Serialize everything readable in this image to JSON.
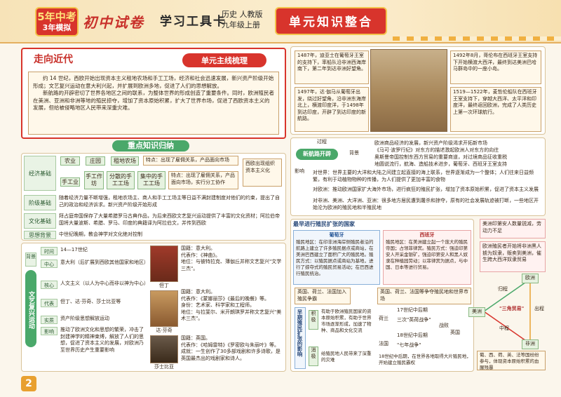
{
  "header": {
    "logo_top": "5年中考",
    "logo_bottom": "3年模拟",
    "brand": "初中试卷",
    "tool": "学习工具卡",
    "subject_line1": "历史 人教版",
    "subject_line2": "九年级上册",
    "unit_banner": "单元知识整合"
  },
  "intro": {
    "title": "走向近代",
    "ribbon": "单元主线梳理",
    "para1": "约 14 世纪，西欧开始出现资本主义租地农场和手工工场，经济和社会迅速发展，新兴资产阶级开始形成；文艺复兴运动在意大利兴起，并扩展到欧洲多地，促进了人们的思想解放。",
    "para2": "新航路的开辟密切了世界各地区之间的联系，为整体世界的形成创造了重要条件。同时，欧洲殖民者在美洲、亚洲和非洲等地的殖民掠夺，增加了资本原始积累，扩大了世界市场，促进了西欧资本主义的发展，但给被侵略地区人民带来深重灾难。"
  },
  "summary": {
    "ribbon": "重点知识归纳",
    "labels": {
      "economy": "经济基础",
      "class": "阶级基础",
      "culture": "文化基础",
      "thought": "思想背景"
    },
    "agri": "农业",
    "manor": "庄园",
    "farm": "租地农场",
    "agri_feature": "特点：出现了雇佣关系，产品面向市场",
    "handicraft": "手工业",
    "hand_work": "手工作坊",
    "scattered": "分散的手工工场",
    "concentrated": "集中的手工工场",
    "hand_feature": "特点：出现了雇佣关系，产品面向市场，实行分工协作",
    "result": "西欧出现组织资本主义化",
    "class_text": "随着经济力量不断增强，租地农场主、商人和手工工场主等日益不满封建制度对他们的约束，提出了自己的政治和经济诉求。新兴资产阶级开始形成",
    "culture_text": "拜占庭帝国保存了大量希腊罗马古典作品，为后来西欧文艺复兴运动提供了丰富的文化资材；阿拉伯帝国将大量波斯、希腊、罗马、印度的典籍译为阿拉伯文，并传到西欧",
    "thought_text": "中世纪晚期，教会神学对文化绝对控制"
  },
  "renaissance": {
    "side_top": "背景",
    "side_title": "文艺复兴运动",
    "rows": [
      {
        "label": "时间",
        "text": "14—17世纪"
      },
      {
        "label": "中心",
        "text": "意大利（后扩展到西欧其他国家和地区）"
      },
      {
        "label": "核心",
        "text": "人文主义（以人为中心而非以神为中心）"
      },
      {
        "label": "代表",
        "text": "但丁、达·芬奇、莎士比亚等"
      },
      {
        "label": "实质",
        "text": "资产阶级思想解放运动"
      },
      {
        "label": "影响",
        "text": "推动了欧洲文化和思想的繁荣，冲击了封建神学的精神束缚，解放了人们的思想，促进了资本主义的发展，对欧洲乃至世界历史产生重要影响"
      }
    ],
    "people": [
      {
        "name": "但丁",
        "info": "国籍：意大利。\n代表作：《神曲》。\n地位：与彼特拉克、薄伽丘并称文艺复兴\"文学三杰\"。"
      },
      {
        "name": "达·芬奇",
        "info": "国籍：意大利。\n代表作：《蒙娜丽莎》《最后的晚餐》等。\n身份：艺术家、科学家和工程师。\n地位：与拉斐尔、米开朗琪罗并称文艺复兴\"美术三杰\"。"
      },
      {
        "name": "莎士比亚",
        "info": "国籍：英国。\n代表作：《哈姆雷特》《罗密欧与朱丽叶》等。\n成就：一生创作了30多部戏剧和许多诗歌，是英国最杰出的戏剧家和诗人。"
      }
    ]
  },
  "voyages": {
    "dias": "1487年，迪亚士在葡萄牙王室的支持下，率船队沿非洲西海岸南下，第二年到达非洲好望角。",
    "columbus": "1492年8月，哥伦布在西班牙王室支持下开始横渡大西洋，最终到达美洲巴哈马群岛中的一座小岛。",
    "gama": "1497年，达·伽马从葡萄牙出发，绕过好望角，沿非洲东海岸北上，横渡印度洋，于1498年到达印度，开辟了到达印度的新航路。",
    "magellan": "1519—1522年，麦哲伦船队在西班牙王室支持下，穿越大西洋、太平洋和印度洋，最终返回欧洲，完成了人类历史上第一次环球航行。"
  },
  "newroute": {
    "title": "新航路开辟",
    "process": "过程",
    "background": "背景",
    "impact": "影响",
    "bg1": "欧洲商品经济的发展，新兴资产阶级渴求开拓新市场",
    "bg2": "《马可·波罗行纪》对东方的描述激起欧洲人对东方的向往",
    "bg3": "奥斯曼帝国控制东西方贸易的重要商道，对过境商品征收重税",
    "bg4": "地圆说流行，航海、造船技术进步，葡萄牙、西班牙王室支持",
    "imp1": "对世界：世界主要的大洋和大陆之间建立起直接的海上联系，世界逐渐成为一个整体；人们往来日益频繁，有利于动植物物种的传播，为人们提供了更加丰富的食物",
    "imp2": "对欧洲：推动欧洲国家扩大海外市场，进行疯狂的殖民扩张，增加了资本原始积累，促进了资本主义发展",
    "imp3": "对非洲、美洲、大洋洲、亚洲：很多地方居民遭到屠杀和掠夺，原有的社会发展轨迹被打断，一些地区开始沦为欧洲的殖民地和半殖民地"
  },
  "colonial": {
    "title": "最早进行殖民扩张的国家",
    "portugal": "葡萄牙",
    "spain": "西班牙",
    "pt_text": "殖民地区：在印非洲海岸侧殖民者沿的航路上建立了许多殖民据点或商站，在美洲巴西建立了面积广大的殖民地。殖民方式：以殖民据点或商站为基地，进行了掠夺式的殖民贸易活动；在巴西进行殖民统治。",
    "es_text": "殖民地区：在美洲建立起一个庞大的殖民帝国；占领菲律宾。殖民方式：强迫印第安人开采金银矿，强迫印第安人和黑人奴隶在种植园劳动；以菲律宾为据点，与中国、日本等进行贸易。",
    "later": "英国、荷兰、法国加入殖民争霸",
    "side": "早期殖民扩张的影响",
    "positive": "积极",
    "negative": "消极",
    "pos_text": "有助于欧洲殖民国家的资本原始积累，有助于世界市场逐渐形成，加速了物种、商品和文化交流",
    "neg_text": "给殖民地人民带来了深重的灾难",
    "rivals": "英国、荷兰、法国等争夺殖民地和世界市场",
    "c17": "17世纪中后期",
    "c18": "18世纪中后期",
    "sea": "三次\"英荷战争\"",
    "seven": "\"七年战争\"",
    "holland": "荷兰",
    "britain": "英国",
    "france": "法国",
    "defeat": "战败",
    "result": "18世纪中后期，在世界各地取得大片殖民地，开始建立殖民霸权"
  },
  "triangle": {
    "note_top": "美洲印第安人数量锐减，劳动力不足",
    "note_mid": "欧洲殖民者开始将非洲黑人掳为奴隶，贩卖到美洲，催生跨大西洋奴隶贸易",
    "europe": "欧洲",
    "america": "美洲",
    "africa": "非洲",
    "center": "\"三角贸易\"",
    "outward": "出程",
    "middle": "中程",
    "homeward": "归程",
    "bottom": "葡、西、荷、英、法等国纷纷参与，体现资本原始积累的血腥残暴"
  },
  "page": "2"
}
